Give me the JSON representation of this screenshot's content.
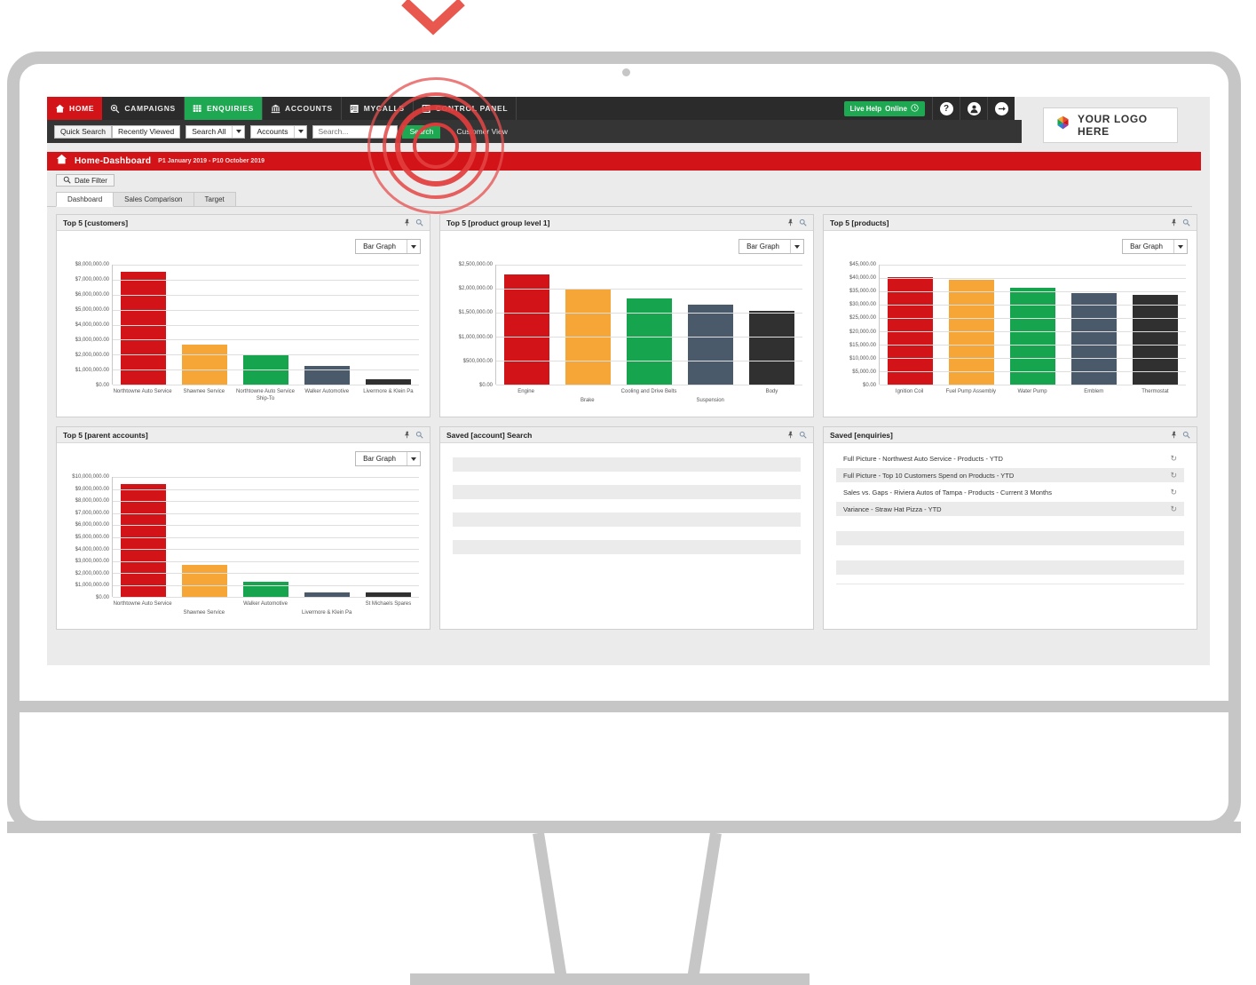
{
  "colors": {
    "brand_red": "#d21317",
    "green": "#1ea851",
    "dark": "#2b2b2b",
    "bar_red": "#d21317",
    "bar_orange": "#f5a637",
    "bar_green": "#16a44f",
    "bar_slate": "#4a5a6a",
    "bar_black": "#303030",
    "ripple_red": "#e64c4c"
  },
  "topnav": {
    "items": [
      {
        "label": "HOME",
        "icon": "home-icon",
        "state": "home"
      },
      {
        "label": "CAMPAIGNS",
        "icon": "magnifier-person-icon",
        "state": "normal"
      },
      {
        "label": "ENQUIRIES",
        "icon": "grid-search-icon",
        "state": "active"
      },
      {
        "label": "ACCOUNTS",
        "icon": "bank-icon",
        "state": "normal"
      },
      {
        "label": "MYCALLS",
        "icon": "checklist-icon",
        "state": "normal"
      },
      {
        "label": "CONTROL PANEL",
        "icon": "panel-icon",
        "state": "normal"
      }
    ],
    "live_help": "Live Help ",
    "live_help_strong": "Online",
    "help_icon": "question-icon",
    "account_icon": "user-icon",
    "logout_icon": "arrow-right-icon"
  },
  "logo": {
    "text": "YOUR LOGO HERE",
    "icon": "pinwheel-logo-icon"
  },
  "searchbar": {
    "quick_search": "Quick Search",
    "recently_viewed": "Recently Viewed",
    "scope": "Search All",
    "entity": "Accounts",
    "placeholder": "Search...",
    "go_label": "Search",
    "customer_view": "Customer View"
  },
  "crumb": {
    "title": "Home-Dashboard",
    "range": "P1 January 2019 - P10 October 2019",
    "icon": "home-icon"
  },
  "date_filter": {
    "label": "Date Filter",
    "icon": "search-icon"
  },
  "tabs": [
    {
      "label": "Dashboard",
      "active": true
    },
    {
      "label": "Sales Comparison",
      "active": false
    },
    {
      "label": "Target",
      "active": false
    }
  ],
  "panels": {
    "customers": {
      "title": "Top 5 [customers]",
      "graph_type": "Bar Graph",
      "pin_icon": "pin-icon",
      "zoom_icon": "magnifier-icon"
    },
    "product_group": {
      "title": "Top 5 [product group level 1]",
      "graph_type": "Bar Graph",
      "pin_icon": "pin-icon",
      "zoom_icon": "magnifier-icon"
    },
    "products": {
      "title": "Top 5 [products]",
      "graph_type": "Bar Graph",
      "pin_icon": "pin-icon",
      "zoom_icon": "magnifier-icon"
    },
    "parent_accounts": {
      "title": "Top 5 [parent accounts]",
      "graph_type": "Bar Graph",
      "pin_icon": "pin-icon",
      "zoom_icon": "magnifier-icon"
    },
    "saved_account_search": {
      "title": "Saved [account] Search",
      "pin_icon": "pin-icon",
      "zoom_icon": "magnifier-icon",
      "placeholder_rows": 4
    },
    "saved_enquiries": {
      "title": "Saved [enquiries]",
      "pin_icon": "pin-icon",
      "zoom_icon": "magnifier-icon",
      "refresh_icon": "refresh-icon",
      "items": [
        "Full Picture - Northwest Auto Service - Products - YTD",
        "Full Picture - Top 10 Customers Spend on Products - YTD",
        "Sales vs. Gaps - Riviera Autos of Tampa - Products - Current 3 Months",
        "Variance - Straw Hat Pizza - YTD"
      ],
      "blank_rows": 2
    }
  },
  "chart_data": [
    {
      "id": "customers",
      "type": "bar",
      "title": "Top 5 [customers]",
      "xlabel": "",
      "ylabel": "",
      "ylim": [
        0,
        8000000
      ],
      "grid": true,
      "ytick_labels": [
        "$8,000,000.00",
        "$7,000,000.00",
        "$6,000,000.00",
        "$5,000,000.00",
        "$4,000,000.00",
        "$3,000,000.00",
        "$2,000,000.00",
        "$1,000,000.00",
        "$0.00"
      ],
      "categories": [
        "Northtowne Auto Service",
        "Shawnee Service",
        "Northtowne Auto Service Ship-To",
        "Walker Automotive",
        "Livermore & Klein Pa"
      ],
      "values": [
        7530000,
        2680000,
        1950000,
        1250000,
        330000
      ],
      "bar_colors": [
        "#d21317",
        "#f5a637",
        "#16a44f",
        "#4a5a6a",
        "#303030"
      ]
    },
    {
      "id": "product_group",
      "type": "bar",
      "title": "Top 5 [product group level 1]",
      "xlabel": "",
      "ylabel": "",
      "ylim": [
        0,
        2500000
      ],
      "grid": true,
      "ytick_labels": [
        "$2,500,000.00",
        "$2,000,000.00",
        "$1,500,000.00",
        "$1,000,000.00",
        "$500,000.00",
        "$0.00"
      ],
      "categories": [
        "Engine",
        "Brake",
        "Cooling and Drive Belts",
        "Suspension",
        "Body"
      ],
      "values": [
        2300000,
        1980000,
        1800000,
        1670000,
        1540000
      ],
      "bar_colors": [
        "#d21317",
        "#f5a637",
        "#16a44f",
        "#4a5a6a",
        "#303030"
      ]
    },
    {
      "id": "products",
      "type": "bar",
      "title": "Top 5 [products]",
      "xlabel": "",
      "ylabel": "",
      "ylim": [
        0,
        45000
      ],
      "grid": true,
      "ytick_labels": [
        "$45,000.00",
        "$40,000.00",
        "$35,000.00",
        "$30,000.00",
        "$25,000.00",
        "$20,000.00",
        "$15,000.00",
        "$10,000.00",
        "$5,000.00",
        "$0.00"
      ],
      "categories": [
        "Ignition Coil",
        "Fuel Pump Assembly",
        "Water Pump",
        "Emblem",
        "Thermostat"
      ],
      "values": [
        40400,
        39300,
        36500,
        34300,
        33700
      ],
      "bar_colors": [
        "#d21317",
        "#f5a637",
        "#16a44f",
        "#4a5a6a",
        "#303030"
      ]
    },
    {
      "id": "parent_accounts",
      "type": "bar",
      "title": "Top 5 [parent accounts]",
      "xlabel": "",
      "ylabel": "",
      "ylim": [
        0,
        10000000
      ],
      "grid": true,
      "ytick_labels": [
        "$10,000,000.00",
        "$9,000,000.00",
        "$8,000,000.00",
        "$7,000,000.00",
        "$6,000,000.00",
        "$5,000,000.00",
        "$4,000,000.00",
        "$3,000,000.00",
        "$2,000,000.00",
        "$1,000,000.00",
        "$0.00"
      ],
      "categories": [
        "Northtowne Auto Service",
        "Shawnee Service",
        "Walker Automotive",
        "Livermore & Klein Pa",
        "St Michaels Spares"
      ],
      "values": [
        9420000,
        2700000,
        1230000,
        380000,
        370000
      ],
      "bar_colors": [
        "#d21317",
        "#f5a637",
        "#16a44f",
        "#4a5a6a",
        "#303030"
      ]
    }
  ]
}
